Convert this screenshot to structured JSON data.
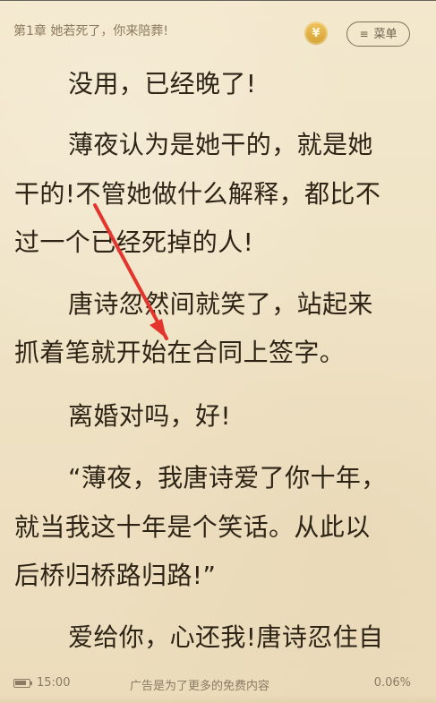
{
  "header": {
    "chapter_title": "第1章 她若死了，你来陪葬!",
    "coin_symbol": "¥",
    "menu_label": "菜单",
    "menu_icon": "≡"
  },
  "content": {
    "lines": [
      "没用，已经晚了!",
      "薄夜认为是她干的，就是她",
      "干的!不管她做什么解释，都比不",
      "过一个已经死掉的人!",
      "唐诗忽然间就笑了，站起来",
      "抓着笔就开始在合同上签字。",
      "离婚对吗，好!",
      "“薄夜，我唐诗爱了你十年，",
      "就当我这十年是个笑话。从此以",
      "后桥归桥路归路!”",
      "爱给你，心还我!唐诗忍住自"
    ]
  },
  "footer": {
    "time": "15:00",
    "ad_text": "广告是为了更多的免费内容",
    "progress": "0.06%"
  },
  "colors": {
    "background": "#efe3c7",
    "text": "#2d2416",
    "header_text": "#8b7a5e",
    "coin": "#d6a234",
    "arrow": "#e3352d"
  },
  "icons": {
    "coin": "coin-icon",
    "menu": "menu-icon",
    "battery": "battery-icon"
  }
}
